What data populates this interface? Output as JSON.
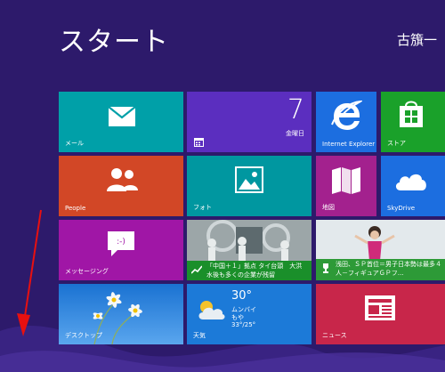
{
  "screen": {
    "title": "スタート",
    "user": "古籏一"
  },
  "tiles": {
    "mail": {
      "label": "メール",
      "color": "#00a0a8",
      "icon": "mail-icon"
    },
    "calendar": {
      "day_number": "7",
      "weekday": "金曜日",
      "color": "#5b2ebf",
      "icon": "calendar-icon"
    },
    "ie": {
      "label": "Internet Explorer",
      "color": "#1c6ee0",
      "icon": "internet-explorer-icon"
    },
    "store": {
      "label": "ストア",
      "color": "#1aa12a",
      "icon": "store-bag-icon"
    },
    "people": {
      "label": "People",
      "color": "#d24726",
      "icon": "people-icon"
    },
    "photos": {
      "label": "フォト",
      "color": "#0097a0",
      "icon": "photo-icon"
    },
    "maps": {
      "label": "地図",
      "color": "#a3218e",
      "icon": "map-icon"
    },
    "skydrive": {
      "label": "SkyDrive",
      "color": "#1c6ee0",
      "icon": "cloud-icon"
    },
    "messaging": {
      "label": "メッセージング",
      "color": "#a016a6",
      "icon": "messaging-icon"
    },
    "finance": {
      "caption": "「中国＋１」拠点 タイ台頭　大洪水後も多くの企業が残留",
      "color": "#1a8f2a",
      "icon": "chart-up-icon"
    },
    "sports": {
      "caption": "浅田、ＳＰ首位＝男子日本勢は最多４人－フィギュアＧＰフ…",
      "color": "#2d9a37",
      "icon": "trophy-icon"
    },
    "desktop": {
      "label": "デスクトップ",
      "color": "#1c7ad8",
      "icon": "desktop-flower-image"
    },
    "weather": {
      "label": "天気",
      "temp": "30°",
      "city": "ムンバイ",
      "condition": "もや",
      "range": "33°/25°",
      "color": "#1c7ad8",
      "icon": "partly-cloudy-icon"
    },
    "news": {
      "label": "ニュース",
      "color": "#c8264a",
      "icon": "newspaper-icon"
    }
  },
  "annotation": {
    "arrow_color": "#e81010"
  }
}
